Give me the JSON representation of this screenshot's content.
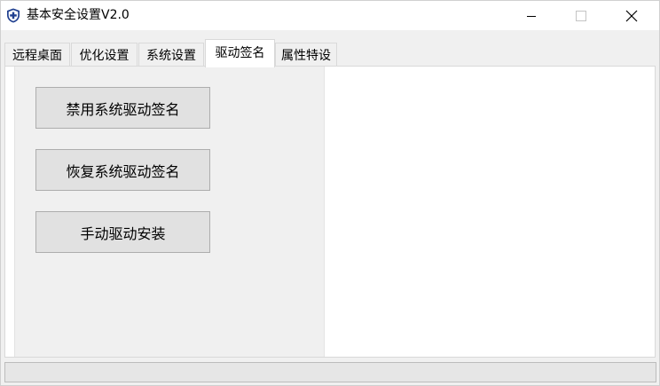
{
  "window": {
    "title": "基本安全设置V2.0",
    "icon": "shield-icon",
    "controls": [
      "minimize-icon",
      "maximize-icon",
      "close-icon"
    ]
  },
  "tabs": [
    {
      "label": "远程桌面",
      "active": false
    },
    {
      "label": "优化设置",
      "active": false
    },
    {
      "label": "系统设置",
      "active": false
    },
    {
      "label": "驱动签名",
      "active": true
    },
    {
      "label": "属性特设",
      "active": false
    }
  ],
  "actions": {
    "disable_signing": "禁用系统驱动签名",
    "restore_signing": "恢复系统驱动签名",
    "manual_install": "手动驱动安装"
  },
  "colors": {
    "accent": "#1f3f8f",
    "window_bg": "#f0f0f0",
    "button_bg": "#e1e1e1",
    "button_border": "#adadad"
  }
}
